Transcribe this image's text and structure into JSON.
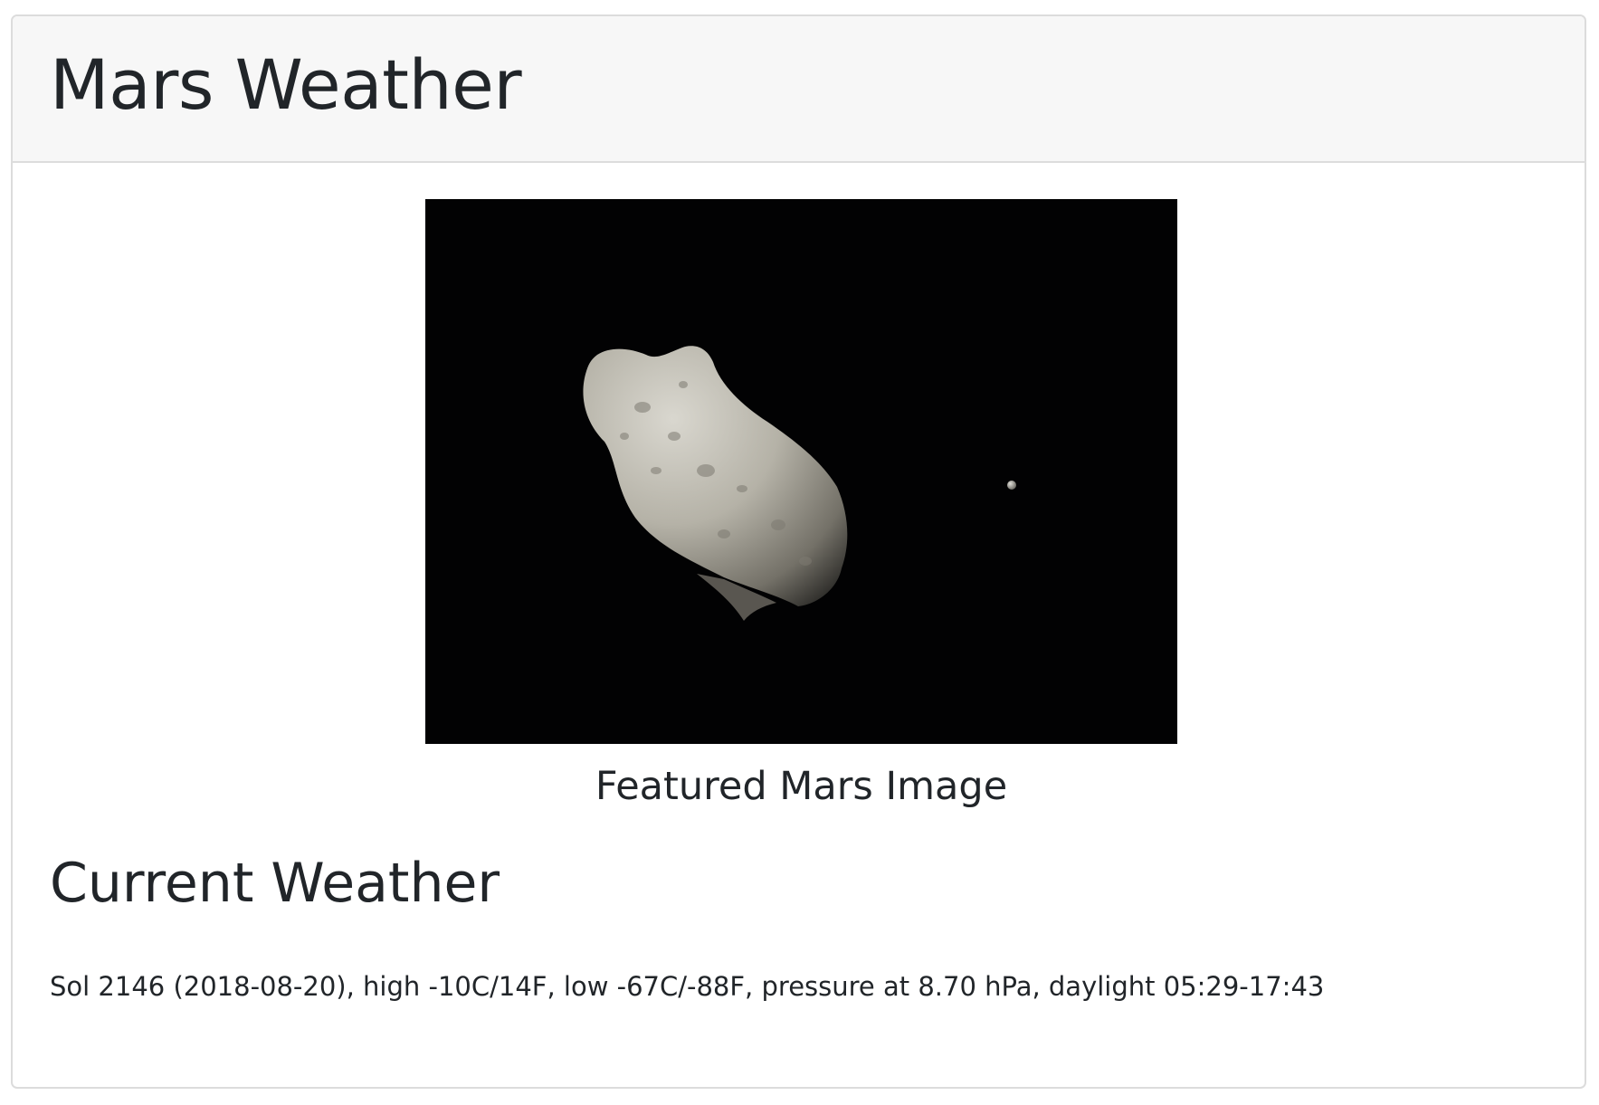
{
  "header": {
    "title": "Mars Weather"
  },
  "featured_image": {
    "alt": "Featured Mars Image",
    "caption": "Featured Mars Image",
    "icon": "asteroid-image"
  },
  "weather": {
    "heading": "Current Weather",
    "report": "Sol 2146 (2018-08-20), high -10C/14F, low -67C/-88F, pressure at 8.70 hPa, daylight 05:29-17:43"
  },
  "colors": {
    "header_background": "#f7f7f7",
    "border": "#dcdcdc",
    "text": "#212529",
    "image_background": "#020203"
  }
}
